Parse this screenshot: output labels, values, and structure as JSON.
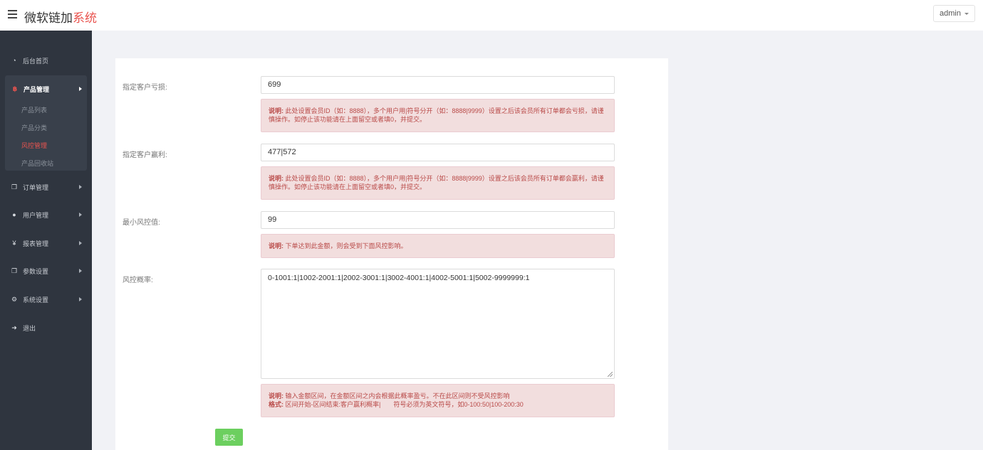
{
  "header": {
    "brand_main": "微软链加",
    "brand_accent": "系统",
    "user_label": "admin"
  },
  "sidebar": {
    "items": [
      {
        "label": "后台首页",
        "icon": "dashboard-icon"
      },
      {
        "label": "产品管理",
        "icon": "bitcoin-icon"
      },
      {
        "label": "订单管理",
        "icon": "copy-icon"
      },
      {
        "label": "用户管理",
        "icon": "user-icon"
      },
      {
        "label": "报表管理",
        "icon": "yen-icon"
      },
      {
        "label": "参数设置",
        "icon": "copy-icon"
      },
      {
        "label": "系统设置",
        "icon": "gears-icon"
      },
      {
        "label": "退出",
        "icon": "sign-out-icon"
      }
    ],
    "submenu": [
      {
        "label": "产品列表"
      },
      {
        "label": "产品分类"
      },
      {
        "label": "风控管理"
      },
      {
        "label": "产品回收站"
      }
    ]
  },
  "form": {
    "loss_label": "指定客户亏损:",
    "loss_value": "699",
    "loss_note_title": "说明:",
    "loss_note": "此处设置会员ID（如：8888），多个用户用|符号分开（如：8888|9999）设置之后该会员所有订单都会亏损，请谨慎操作。如停止该功能请在上面留空或者填0，并提交。",
    "win_label": "指定客户赢利:",
    "win_value": "477|572",
    "win_note_title": "说明:",
    "win_note": "此处设置会员ID（如：8888），多个用户用|符号分开（如：8888|9999）设置之后该会员所有订单都会赢利，请谨慎操作。如停止该功能请在上面留空或者填0，并提交。",
    "min_label": "最小风控值:",
    "min_value": "99",
    "min_note_title": "说明:",
    "min_note": "下单达到此金额，则会受到下面风控影响。",
    "prob_label": "风控概率:",
    "prob_value": "0-1001:1|1002-2001:1|2002-3001:1|3002-4001:1|4002-5001:1|5002-9999999:1",
    "prob_note_title": "说明:",
    "prob_note": "输入金额区间，在金额区间之内会根据此概率盈亏。不在此区间则不受风控影响",
    "prob_format_title": "格式:",
    "prob_format": "区间开始-区间结束:客户赢利概率|　　符号必须为英文符号，如0-100:50|100-200:30",
    "submit_label": "提交"
  },
  "colors": {
    "accent": "#e9544f",
    "sidebar_bg": "#2f353f",
    "alert_bg": "#f2dede",
    "alert_text": "#b94a48",
    "submit_bg": "#6ccf5f"
  }
}
